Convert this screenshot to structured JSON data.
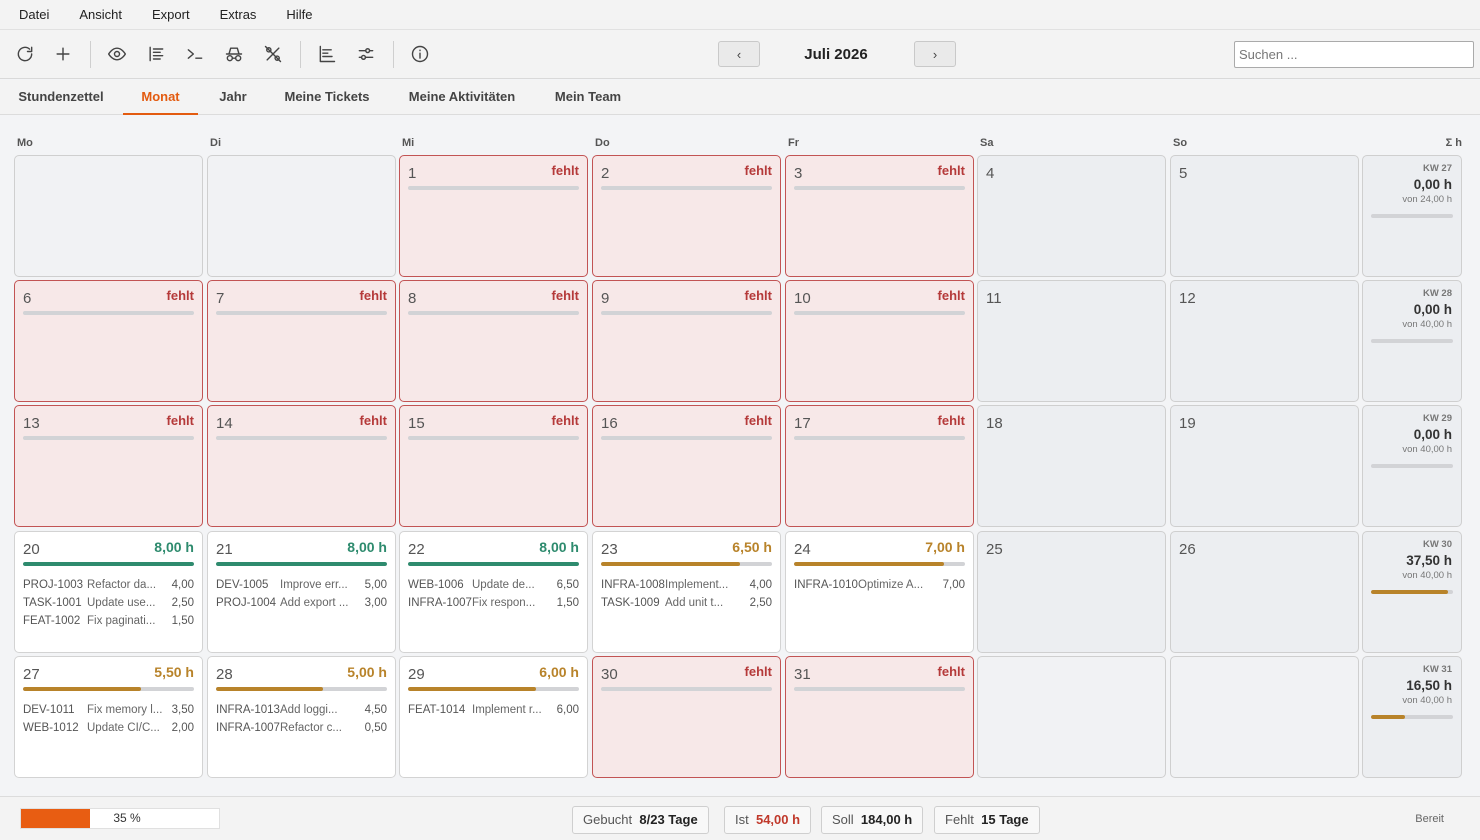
{
  "menu": [
    "Datei",
    "Ansicht",
    "Export",
    "Extras",
    "Hilfe"
  ],
  "toolbar": {
    "icons": [
      "refresh-icon",
      "plus-icon",
      "eye-icon",
      "list-icon",
      "terminal-icon",
      "incognito-icon",
      "percent-icon",
      "gantt-icon",
      "sliders-icon",
      "info-icon"
    ],
    "prev": "‹",
    "next": "›",
    "month": "Juli 2026",
    "search_placeholder": "Suchen ..."
  },
  "tabs": [
    "Stundenzettel",
    "Monat",
    "Jahr",
    "Meine Tickets",
    "Meine Aktivitäten",
    "Mein Team"
  ],
  "active_tab": "Monat",
  "weekday_headers": [
    "Mo",
    "Di",
    "Mi",
    "Do",
    "Fr",
    "Sa",
    "So",
    "Σ h"
  ],
  "weeks": [
    {
      "summary": {
        "kw": "KW 27",
        "hours": "0,00 h",
        "target": "von 24,00 h",
        "fill": 0
      },
      "days": [
        {
          "state": "empty"
        },
        {
          "state": "empty"
        },
        {
          "state": "missing",
          "num": "1",
          "status": "fehlt"
        },
        {
          "state": "missing",
          "num": "2",
          "status": "fehlt"
        },
        {
          "state": "missing",
          "num": "3",
          "status": "fehlt"
        },
        {
          "state": "weekend",
          "num": "4"
        },
        {
          "state": "weekend",
          "num": "5"
        }
      ]
    },
    {
      "summary": {
        "kw": "KW 28",
        "hours": "0,00 h",
        "target": "von 40,00 h",
        "fill": 0
      },
      "days": [
        {
          "state": "missing",
          "num": "6",
          "status": "fehlt"
        },
        {
          "state": "missing",
          "num": "7",
          "status": "fehlt"
        },
        {
          "state": "missing",
          "num": "8",
          "status": "fehlt"
        },
        {
          "state": "missing",
          "num": "9",
          "status": "fehlt"
        },
        {
          "state": "missing",
          "num": "10",
          "status": "fehlt"
        },
        {
          "state": "weekend",
          "num": "11"
        },
        {
          "state": "weekend",
          "num": "12"
        }
      ]
    },
    {
      "summary": {
        "kw": "KW 29",
        "hours": "0,00 h",
        "target": "von 40,00 h",
        "fill": 0
      },
      "days": [
        {
          "state": "missing",
          "num": "13",
          "status": "fehlt"
        },
        {
          "state": "missing",
          "num": "14",
          "status": "fehlt"
        },
        {
          "state": "missing",
          "num": "15",
          "status": "fehlt"
        },
        {
          "state": "missing",
          "num": "16",
          "status": "fehlt"
        },
        {
          "state": "missing",
          "num": "17",
          "status": "fehlt"
        },
        {
          "state": "weekend",
          "num": "18"
        },
        {
          "state": "weekend",
          "num": "19"
        }
      ]
    },
    {
      "summary": {
        "kw": "KW 30",
        "hours": "37,50 h",
        "target": "von 40,00 h",
        "fill": 0.94
      },
      "days": [
        {
          "state": "filled",
          "num": "20",
          "status": "8,00 h",
          "fill": 1.0,
          "level": "full",
          "entries": [
            [
              "PROJ-1003",
              "Refactor da...",
              "4,00"
            ],
            [
              "TASK-1001",
              "Update use...",
              "2,50"
            ],
            [
              "FEAT-1002",
              "Fix paginati...",
              "1,50"
            ]
          ]
        },
        {
          "state": "filled",
          "num": "21",
          "status": "8,00 h",
          "fill": 1.0,
          "level": "full",
          "entries": [
            [
              "DEV-1005",
              "Improve err...",
              "5,00"
            ],
            [
              "PROJ-1004",
              "Add export ...",
              "3,00"
            ]
          ]
        },
        {
          "state": "filled",
          "num": "22",
          "status": "8,00 h",
          "fill": 1.0,
          "level": "full",
          "entries": [
            [
              "WEB-1006",
              "Update de...",
              "6,50"
            ],
            [
              "INFRA-1007",
              "Fix respon...",
              "1,50"
            ]
          ]
        },
        {
          "state": "filled",
          "num": "23",
          "status": "6,50 h",
          "fill": 0.8125,
          "level": "partial",
          "entries": [
            [
              "INFRA-1008",
              "Implement...",
              "4,00"
            ],
            [
              "TASK-1009",
              "Add unit t...",
              "2,50"
            ]
          ]
        },
        {
          "state": "filled",
          "num": "24",
          "status": "7,00 h",
          "fill": 0.875,
          "level": "partial",
          "entries": [
            [
              "INFRA-1010",
              "Optimize A...",
              "7,00"
            ]
          ]
        },
        {
          "state": "weekend",
          "num": "25"
        },
        {
          "state": "weekend",
          "num": "26"
        }
      ]
    },
    {
      "summary": {
        "kw": "KW 31",
        "hours": "16,50 h",
        "target": "von 40,00 h",
        "fill": 0.41
      },
      "days": [
        {
          "state": "filled",
          "num": "27",
          "status": "5,50 h",
          "fill": 0.6875,
          "level": "partial",
          "entries": [
            [
              "DEV-1011",
              "Fix memory l...",
              "3,50"
            ],
            [
              "WEB-1012",
              "Update CI/C...",
              "2,00"
            ]
          ]
        },
        {
          "state": "filled",
          "num": "28",
          "status": "5,00 h",
          "fill": 0.625,
          "level": "partial",
          "entries": [
            [
              "INFRA-1013",
              "Add loggi...",
              "4,50"
            ],
            [
              "INFRA-1007",
              "Refactor c...",
              "0,50"
            ]
          ]
        },
        {
          "state": "filled",
          "num": "29",
          "status": "6,00 h",
          "fill": 0.75,
          "level": "partial",
          "entries": [
            [
              "FEAT-1014",
              "Implement r...",
              "6,00"
            ]
          ]
        },
        {
          "state": "missing",
          "num": "30",
          "status": "fehlt"
        },
        {
          "state": "missing",
          "num": "31",
          "status": "fehlt"
        },
        {
          "state": "weekend-empty"
        },
        {
          "state": "weekend-empty"
        }
      ]
    }
  ],
  "colors": {
    "full": "#2e8b6e",
    "partial": "#b8832a",
    "missing": "#b53a3a",
    "accent": "#e35b10"
  },
  "status": {
    "progress": 0.35,
    "progress_label": "35 %",
    "gebucht_label": "Gebucht",
    "gebucht_value": "8/23 Tage",
    "ist_label": "Ist",
    "ist_value": "54,00 h",
    "soll_label": "Soll",
    "soll_value": "184,00 h",
    "fehlt_label": "Fehlt",
    "fehlt_value": "15 Tage",
    "ready": "Bereit"
  }
}
